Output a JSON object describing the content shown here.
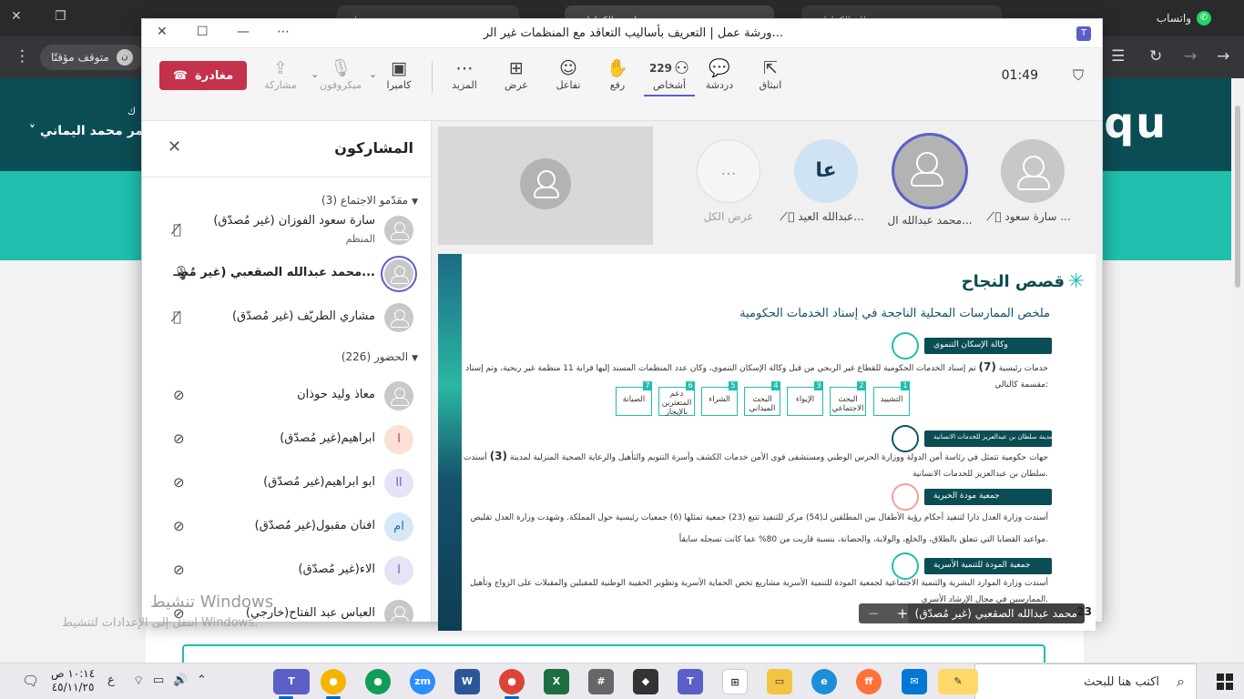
{
  "browser": {
    "tabs": [
      "ورشة عمل",
      "لوحة",
      "نظام الكفاءات",
      "لوحة الكفاءات"
    ],
    "whatsapp": "واتساب",
    "paused": "متوقف مؤقتًا",
    "paused_avatar": "ن"
  },
  "site": {
    "logo": "nqu",
    "user": "عمر محمد اليماني",
    "user_prefix": "ك"
  },
  "teams": {
    "title": "ورشة عمل | التعريف بأساليب التعاقد مع المنظمات غير الر...",
    "leave": "مغادرة",
    "toolbar": {
      "share": "مشاركة",
      "mic": "ميكروفون",
      "camera": "كاميرا",
      "more": "المزيد",
      "view": "عرض",
      "react": "تفاعل",
      "raise": "رفع",
      "people": "أشخاص",
      "people_count": "229",
      "chat": "دردشة",
      "popout": "انبثاق"
    },
    "timer": "01:49"
  },
  "participants": {
    "title": "المشاركون",
    "presenters_header": "مقدّمو الاجتماع (3)",
    "presenters": [
      {
        "name": "سارة سعود الفوزان (غير مُصدّق)",
        "sub": "المنظم",
        "avatar": ""
      },
      {
        "name": "محمد عبدالله الصقعبي (غير مُصـ...",
        "sub": "",
        "avatar": ""
      },
      {
        "name": "مشاري الطريّف (غير مُصدّق)",
        "sub": "",
        "avatar": ""
      }
    ],
    "attendees_header": "الحضور (226)",
    "attendees": [
      {
        "name": "معاذ وليد حوذان",
        "avatar": ""
      },
      {
        "name": "ابراهيم(غير مُصدّق)",
        "avatar": "ا"
      },
      {
        "name": "ابو ابراهيم(غير مُصدّق)",
        "avatar": "اا"
      },
      {
        "name": "افنان مقبول(غير مُصدّق)",
        "avatar": "ام"
      },
      {
        "name": "الاء(غير مُصدّق)",
        "avatar": "ا"
      },
      {
        "name": "العباس عبد الفتاح(خارجي)",
        "avatar": ""
      }
    ]
  },
  "stage": {
    "tiles": [
      {
        "label": "سارة سعود ...",
        "avatar": ""
      },
      {
        "label": "محمد عبدالله ال...",
        "avatar": ""
      },
      {
        "label": "عبدالله العيد...",
        "avatar": "عا"
      },
      {
        "label": "عرض الكل",
        "avatar": "..."
      }
    ],
    "presenter_label": "محمد عبدالله الصقعبي (غير مُصدّق)",
    "slide_number": "23",
    "zoom_plus": "+",
    "zoom_minus": "−"
  },
  "slide": {
    "title": "قصص النجاح",
    "subtitle": "ملخص الممارسات المحلية الناجحة في إسناد الخدمات الحكومية",
    "s1_bar": "وكالة الإسكان التنموي",
    "s1_text1": "تم إسناد الخدمات الحكومية للقطاع غير الربحي من قبل وكالة الإسكان التنموي، وكان عدد المنظمات المسند إليها قرابة 11 منظمة غير ربحية، وتم إسناد",
    "s1_num": "(7)",
    "s1_text1b": "خدمات رئيسية",
    "s1_text2": "مقسمة كالتالي:",
    "steps": [
      {
        "n": "1",
        "label": "التشييد"
      },
      {
        "n": "2",
        "label": "البحث الاجتماعي"
      },
      {
        "n": "3",
        "label": "الإيواء"
      },
      {
        "n": "4",
        "label": "البحث الميداني"
      },
      {
        "n": "5",
        "label": "الشراء"
      },
      {
        "n": "6",
        "label": "دعم المتعثرين بالإيجار"
      },
      {
        "n": "7",
        "label": "الصيانة"
      }
    ],
    "s2_bar": "مدينة سلطان بن عبدالعزيز للخدمات الانسانية",
    "s2_text1a": "أسندت",
    "s2_num": "(3)",
    "s2_text1b": "جهات حكومية تتمثل في رئاسة أمن الدولة ووزارة الحرس الوطني ومستشفى قوى الأمن خدمات الكشف وأسرة التنويم والتأهيل والرعاية الصحية المنزلية لمدينة",
    "s2_text2": "سلطان بن عبدالعزيز للخدمات الانسانية.",
    "s3_bar": "جمعية مودة الخيرية",
    "s3_text1": "أسندت وزارة العدل دارا لتنفيذ أحكام رؤية الأطفال بين المطلقين لـ(54) مركز للتنفيذ تتبع (23) جمعية تمثلها (6) جمعيات رئيسية حول المملكة. وشهدت وزارة العدل تقليص",
    "s3_text2": "مواعيد القضايا التي تتعلق بالطلاق، والخلع، والولاية، والحضانة، بنسبة قاربت من 80% عما كانت تسجله سابقاً.",
    "s4_bar": "جمعية المودة للتنمية الأسرية",
    "s4_text1": "أسندت وزارة الموارد البشرية والتنمية الاجتماعية لجمعية المودة للتنمية الأسرية مشاريع تخص الحماية الأسرية وتطوير الحقيبة الوطنية للمقبلين والمقبلات على الزواج وتأهيل",
    "s4_text2": "الممارسين في مجال الإرشاد الأسري."
  },
  "watermark": {
    "line1": "تنشيط Windows",
    "line2": "انتقل إلى الإعدادات لتنشيط Windows."
  },
  "taskbar": {
    "search": "اكتب هنا للبحث",
    "time": "١٠:١٤ ص",
    "date": "٤٥/١١/٢٥",
    "lang": "ع",
    "apps": [
      "Teams",
      "Chrome",
      "Chrome",
      "Zoom",
      "Word",
      "Chrome",
      "Excel",
      "Calc",
      "Roblox",
      "Teams",
      "Apps",
      "Files",
      "Edge",
      "Firefox",
      "Mail",
      "Paint"
    ]
  }
}
